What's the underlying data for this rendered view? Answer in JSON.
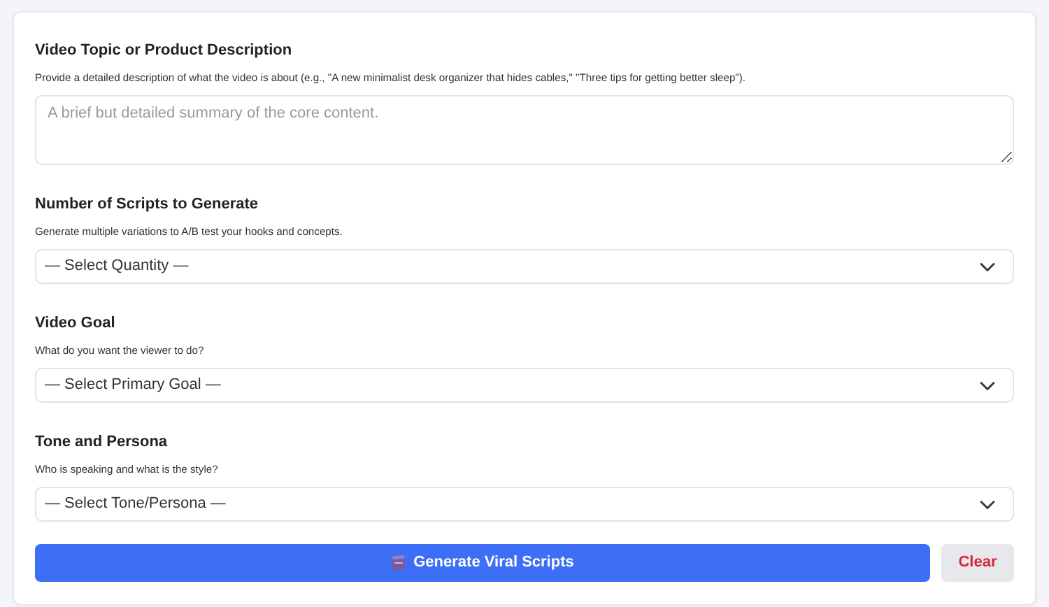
{
  "sections": [
    {
      "kind": "textarea",
      "title": "Video Topic or Product Description",
      "description": "Provide a detailed description of what the video is about (e.g., \"A new minimalist desk organizer that hides cables,\" \"Three tips for getting better sleep\").",
      "placeholder": "A brief but detailed summary of the core content."
    },
    {
      "kind": "select",
      "title": "Number of Scripts to Generate",
      "description": "Generate multiple variations to A/B test your hooks and concepts.",
      "value": "— Select Quantity —"
    },
    {
      "kind": "select",
      "title": "Video Goal",
      "description": "What do you want the viewer to do?",
      "value": "— Select Primary Goal —"
    },
    {
      "kind": "select",
      "title": "Tone and Persona",
      "description": "Who is speaking and what is the style?",
      "value": "— Select Tone/Persona —"
    }
  ],
  "buttons": {
    "generate": "Generate Viral Scripts",
    "clear": "Clear"
  }
}
